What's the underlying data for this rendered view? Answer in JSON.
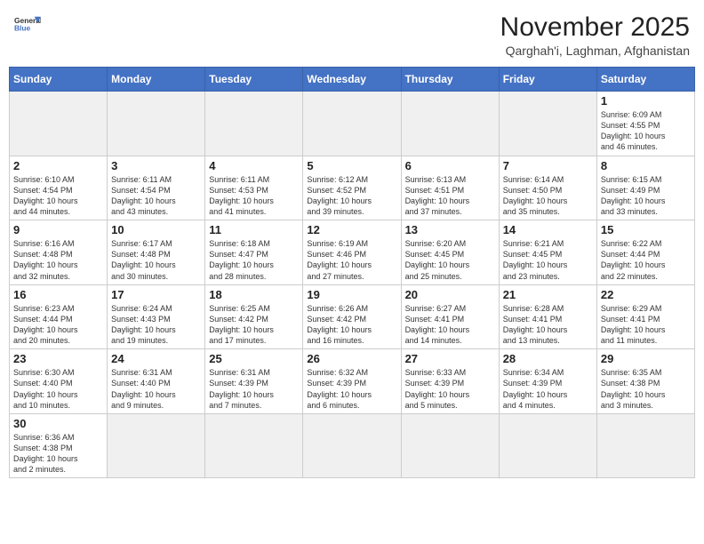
{
  "logo": {
    "text_general": "General",
    "text_blue": "Blue"
  },
  "header": {
    "month_year": "November 2025",
    "location": "Qarghah'i, Laghman, Afghanistan"
  },
  "weekdays": [
    "Sunday",
    "Monday",
    "Tuesday",
    "Wednesday",
    "Thursday",
    "Friday",
    "Saturday"
  ],
  "days": [
    {
      "date": "",
      "info": ""
    },
    {
      "date": "",
      "info": ""
    },
    {
      "date": "",
      "info": ""
    },
    {
      "date": "",
      "info": ""
    },
    {
      "date": "",
      "info": ""
    },
    {
      "date": "",
      "info": ""
    },
    {
      "date": "1",
      "info": "Sunrise: 6:09 AM\nSunset: 4:55 PM\nDaylight: 10 hours\nand 46 minutes."
    },
    {
      "date": "2",
      "info": "Sunrise: 6:10 AM\nSunset: 4:54 PM\nDaylight: 10 hours\nand 44 minutes."
    },
    {
      "date": "3",
      "info": "Sunrise: 6:11 AM\nSunset: 4:54 PM\nDaylight: 10 hours\nand 43 minutes."
    },
    {
      "date": "4",
      "info": "Sunrise: 6:11 AM\nSunset: 4:53 PM\nDaylight: 10 hours\nand 41 minutes."
    },
    {
      "date": "5",
      "info": "Sunrise: 6:12 AM\nSunset: 4:52 PM\nDaylight: 10 hours\nand 39 minutes."
    },
    {
      "date": "6",
      "info": "Sunrise: 6:13 AM\nSunset: 4:51 PM\nDaylight: 10 hours\nand 37 minutes."
    },
    {
      "date": "7",
      "info": "Sunrise: 6:14 AM\nSunset: 4:50 PM\nDaylight: 10 hours\nand 35 minutes."
    },
    {
      "date": "8",
      "info": "Sunrise: 6:15 AM\nSunset: 4:49 PM\nDaylight: 10 hours\nand 33 minutes."
    },
    {
      "date": "9",
      "info": "Sunrise: 6:16 AM\nSunset: 4:48 PM\nDaylight: 10 hours\nand 32 minutes."
    },
    {
      "date": "10",
      "info": "Sunrise: 6:17 AM\nSunset: 4:48 PM\nDaylight: 10 hours\nand 30 minutes."
    },
    {
      "date": "11",
      "info": "Sunrise: 6:18 AM\nSunset: 4:47 PM\nDaylight: 10 hours\nand 28 minutes."
    },
    {
      "date": "12",
      "info": "Sunrise: 6:19 AM\nSunset: 4:46 PM\nDaylight: 10 hours\nand 27 minutes."
    },
    {
      "date": "13",
      "info": "Sunrise: 6:20 AM\nSunset: 4:45 PM\nDaylight: 10 hours\nand 25 minutes."
    },
    {
      "date": "14",
      "info": "Sunrise: 6:21 AM\nSunset: 4:45 PM\nDaylight: 10 hours\nand 23 minutes."
    },
    {
      "date": "15",
      "info": "Sunrise: 6:22 AM\nSunset: 4:44 PM\nDaylight: 10 hours\nand 22 minutes."
    },
    {
      "date": "16",
      "info": "Sunrise: 6:23 AM\nSunset: 4:44 PM\nDaylight: 10 hours\nand 20 minutes."
    },
    {
      "date": "17",
      "info": "Sunrise: 6:24 AM\nSunset: 4:43 PM\nDaylight: 10 hours\nand 19 minutes."
    },
    {
      "date": "18",
      "info": "Sunrise: 6:25 AM\nSunset: 4:42 PM\nDaylight: 10 hours\nand 17 minutes."
    },
    {
      "date": "19",
      "info": "Sunrise: 6:26 AM\nSunset: 4:42 PM\nDaylight: 10 hours\nand 16 minutes."
    },
    {
      "date": "20",
      "info": "Sunrise: 6:27 AM\nSunset: 4:41 PM\nDaylight: 10 hours\nand 14 minutes."
    },
    {
      "date": "21",
      "info": "Sunrise: 6:28 AM\nSunset: 4:41 PM\nDaylight: 10 hours\nand 13 minutes."
    },
    {
      "date": "22",
      "info": "Sunrise: 6:29 AM\nSunset: 4:41 PM\nDaylight: 10 hours\nand 11 minutes."
    },
    {
      "date": "23",
      "info": "Sunrise: 6:30 AM\nSunset: 4:40 PM\nDaylight: 10 hours\nand 10 minutes."
    },
    {
      "date": "24",
      "info": "Sunrise: 6:31 AM\nSunset: 4:40 PM\nDaylight: 10 hours\nand 9 minutes."
    },
    {
      "date": "25",
      "info": "Sunrise: 6:31 AM\nSunset: 4:39 PM\nDaylight: 10 hours\nand 7 minutes."
    },
    {
      "date": "26",
      "info": "Sunrise: 6:32 AM\nSunset: 4:39 PM\nDaylight: 10 hours\nand 6 minutes."
    },
    {
      "date": "27",
      "info": "Sunrise: 6:33 AM\nSunset: 4:39 PM\nDaylight: 10 hours\nand 5 minutes."
    },
    {
      "date": "28",
      "info": "Sunrise: 6:34 AM\nSunset: 4:39 PM\nDaylight: 10 hours\nand 4 minutes."
    },
    {
      "date": "29",
      "info": "Sunrise: 6:35 AM\nSunset: 4:38 PM\nDaylight: 10 hours\nand 3 minutes."
    },
    {
      "date": "30",
      "info": "Sunrise: 6:36 AM\nSunset: 4:38 PM\nDaylight: 10 hours\nand 2 minutes."
    },
    {
      "date": "",
      "info": ""
    },
    {
      "date": "",
      "info": ""
    },
    {
      "date": "",
      "info": ""
    },
    {
      "date": "",
      "info": ""
    },
    {
      "date": "",
      "info": ""
    },
    {
      "date": "",
      "info": ""
    }
  ]
}
